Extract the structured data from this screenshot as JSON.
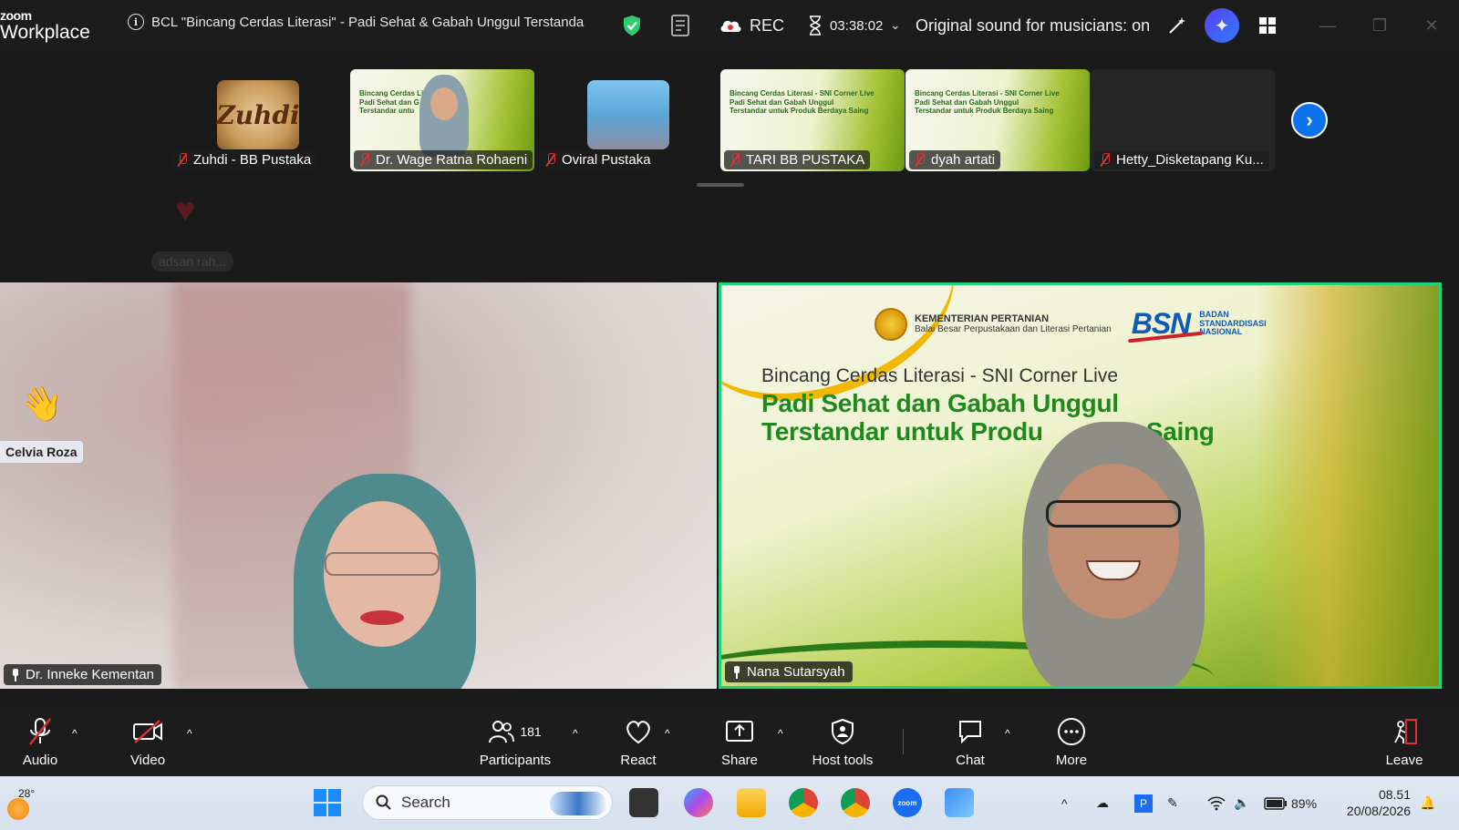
{
  "titlebar": {
    "brand_top": "zoom",
    "brand_bottom": "Workplace",
    "meeting_title": "BCL \"Bincang Cerdas Literasi\" -   Padi Sehat & Gabah Unggul Terstanda",
    "rec_label": "REC",
    "timer": "03:38:02",
    "sound_label": "Original sound for musicians: on"
  },
  "filmstrip": {
    "participants": [
      {
        "name": "Zuhdi - BB Pustaka",
        "avatar_text": "Zuhdi"
      },
      {
        "name": "Dr. Wage Ratna Rohaeni"
      },
      {
        "name": "Oviral Pustaka"
      },
      {
        "name": "TARI BB PUSTAKA"
      },
      {
        "name": "dyah artati"
      },
      {
        "name": "Hetty_Disketapang Ku..."
      }
    ],
    "reaction_name": "adsan rah..."
  },
  "main": {
    "left": {
      "name": "Dr. Inneke Kementan",
      "raised_hand_name": "Celvia Roza"
    },
    "right": {
      "name": "Nana Sutarsyah",
      "slide": {
        "ministry": "KEMENTERIAN PERTANIAN",
        "ministry_sub": "Balai Besar Perpustakaan dan Literasi Pertanian",
        "bsn": "BSN",
        "bsn_sub1": "BADAN",
        "bsn_sub2": "STANDARDISASI",
        "bsn_sub3": "NASIONAL",
        "subtitle": "Bincang Cerdas Literasi - SNI Corner Live",
        "title_line1": "Padi Sehat dan Gabah Unggul",
        "title_line2": "Terstandar untuk Produ        aya Saing"
      }
    }
  },
  "toolbar": {
    "audio": "Audio",
    "video": "Video",
    "participants": "Participants",
    "participants_count": "181",
    "react": "React",
    "share": "Share",
    "host_tools": "Host tools",
    "chat": "Chat",
    "more": "More",
    "leave": "Leave"
  },
  "taskbar": {
    "temperature": "28°",
    "search_placeholder": "Search",
    "battery": "89%",
    "time": "08.51",
    "date": "20/08/2026"
  },
  "colors": {
    "accent_blue": "#0e72ed",
    "active_speaker": "#22d17b",
    "mute_red": "#e03030",
    "slide_green": "#1f8a1c"
  }
}
